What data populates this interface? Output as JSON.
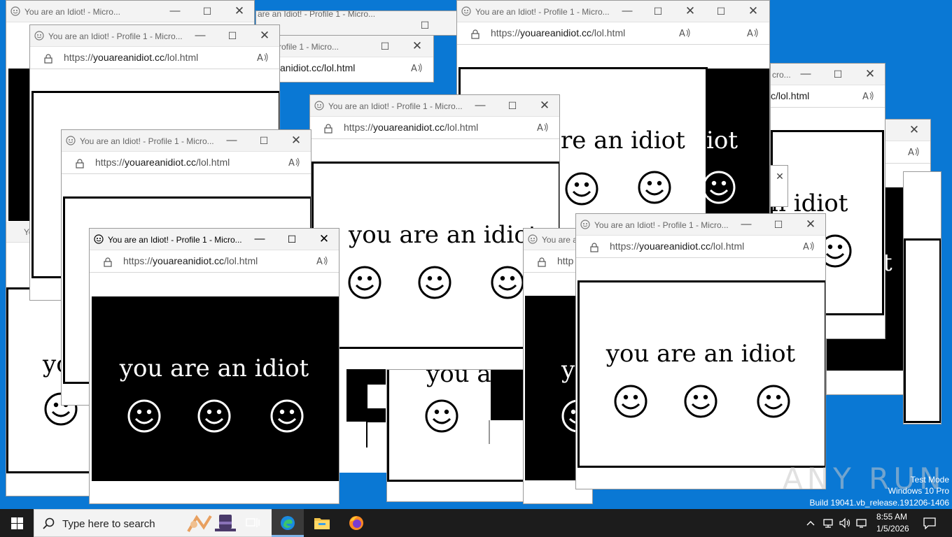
{
  "window": {
    "title": "You are an Idiot! - Profile 1 - Micro...",
    "url_scheme": "https://",
    "url_host": "youareanidiot.cc",
    "url_path": "/lol.html"
  },
  "page": {
    "message": "you are an idiot"
  },
  "fragments": {
    "title_partial_a": "You are an Idiot! - Micro...",
    "title_partial_b": "You are an Idiot! - Micro...",
    "title_partial_c": "You are an Idiot! - Micro...",
    "title_partial_d": "You are an Idiot! - Micro...",
    "title_partial_e": "rofile 1 - Micro...",
    "title_partial_f": "are an Idiot! - Profile 1 - Micro...",
    "title_partial_g": "cro...",
    "title_partial_h": "You are a",
    "title_partial_i": "Yo",
    "url_partial_a": "anidiot.cc/lol.html",
    "url_partial_b": "c/lol.html",
    "url_partial_c": "http",
    "text_partial_a": "re an idiot",
    "text_partial_b": "iot",
    "text_partial_c": "n idiot",
    "text_partial_d": "you a",
    "text_partial_e": "yo",
    "text_partial_f": "y",
    "text_partial_g": "t"
  },
  "taskbar": {
    "search_placeholder": "Type here to search",
    "time": "8:55 AM",
    "date": "1/5/2026"
  },
  "watermark": {
    "brand": "ANY RUN",
    "line1": "Test Mode",
    "line2": "Windows 10 Pro",
    "line3": "Build 19041.vb_release.191206-1406"
  },
  "colors": {
    "desktop": "#0a78d4",
    "taskbar": "#1c1c1c",
    "titlebar": "#f3f3f3"
  },
  "icons": [
    "smiley-favicon-icon",
    "lock-icon",
    "read-aloud-icon",
    "minimize-icon",
    "maximize-icon",
    "close-icon",
    "smiley-icon",
    "windows-start-icon",
    "search-icon",
    "task-view-icon",
    "edge-icon",
    "file-explorer-icon",
    "firefox-icon",
    "chevron-up-icon",
    "network-icon",
    "volume-icon",
    "notification-icon"
  ]
}
